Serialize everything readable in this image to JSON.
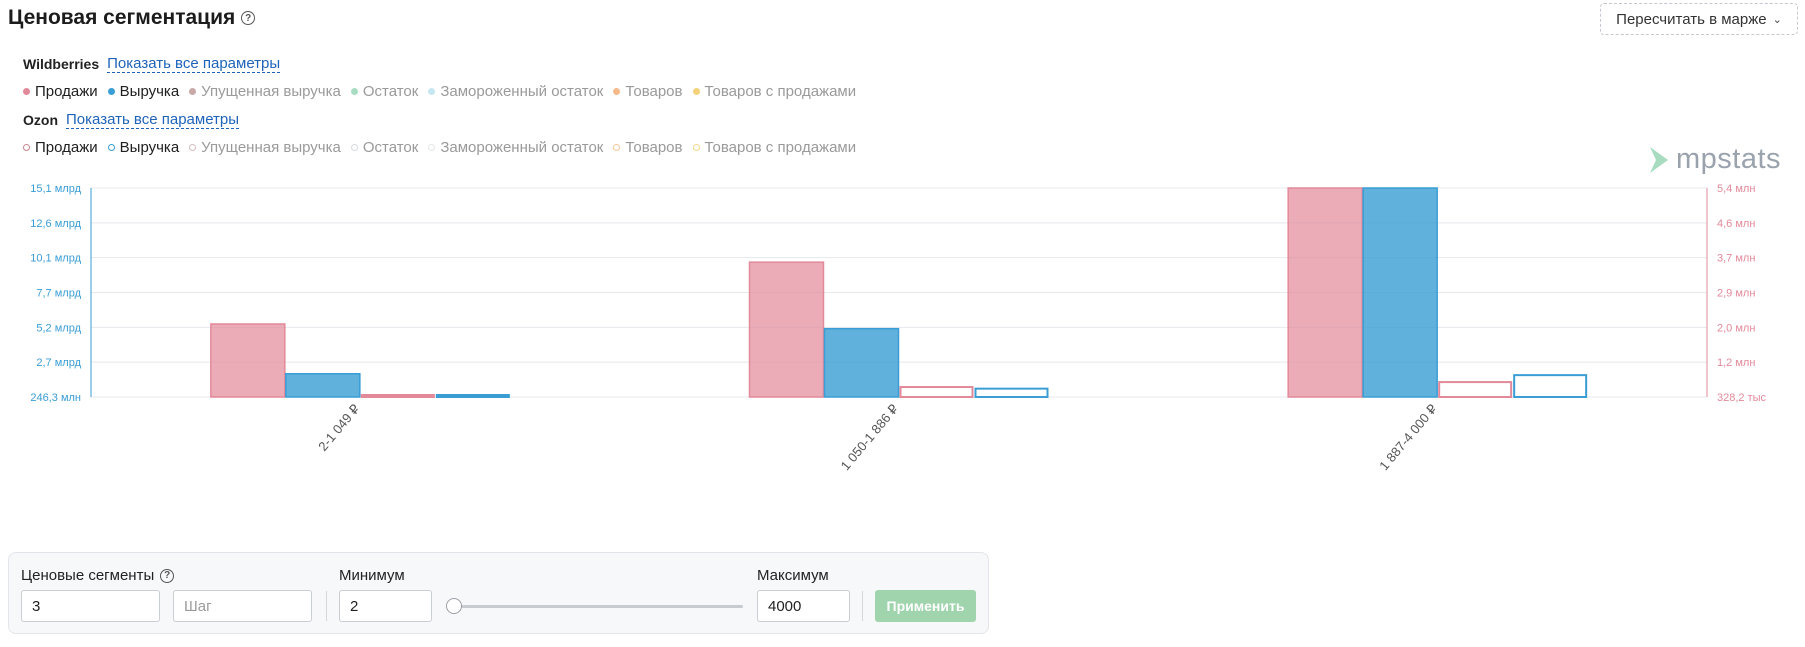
{
  "header": {
    "title": "Ценовая сегментация",
    "recalc_label": "Пересчитать в марже"
  },
  "sources": [
    {
      "name": "Wildberries",
      "link": "Показать все параметры",
      "legend": [
        {
          "label": "Продажи",
          "color": "#e2899a",
          "active": true
        },
        {
          "label": "Выручка",
          "color": "#3a9dd4",
          "active": true
        },
        {
          "label": "Упущенная выручка",
          "color": "#c9a8a8",
          "active": false
        },
        {
          "label": "Остаток",
          "color": "#a8dcc0",
          "active": false
        },
        {
          "label": "Замороженный остаток",
          "color": "#c6e6f0",
          "active": false
        },
        {
          "label": "Товаров",
          "color": "#f6b98a",
          "active": false
        },
        {
          "label": "Товаров с продажами",
          "color": "#f5d27a",
          "active": false
        }
      ]
    },
    {
      "name": "Ozon",
      "link": "Показать все параметры",
      "legend": [
        {
          "label": "Продажи",
          "color": "#c9868f",
          "active": true
        },
        {
          "label": "Выручка",
          "color": "#3a9dd4",
          "active": true
        },
        {
          "label": "Упущенная выручка",
          "color": "#d4bcbc",
          "active": false
        },
        {
          "label": "Остаток",
          "color": "#d8dcdf",
          "active": false
        },
        {
          "label": "Замороженный остаток",
          "color": "#e3e6e8",
          "active": false
        },
        {
          "label": "Товаров",
          "color": "#f6c69a",
          "active": false
        },
        {
          "label": "Товаров с продажами",
          "color": "#f5d88a",
          "active": false
        }
      ]
    }
  ],
  "logo": {
    "text": "mpstats"
  },
  "chart_data": {
    "type": "bar",
    "categories": [
      "2-1 049 ₽",
      "1 050-1 886 ₽",
      "1 887-4 000 ₽"
    ],
    "left_axis": {
      "ticks": [
        "15,1 млрд",
        "12,6 млрд",
        "10,1 млрд",
        "7,7 млрд",
        "5,2 млрд",
        "2,7 млрд",
        "246,3 млн"
      ],
      "range": [
        246300000,
        15100000000
      ],
      "color": "#3a9dd4"
    },
    "right_axis": {
      "ticks": [
        "5,4 млн",
        "4,6 млн",
        "3,7 млн",
        "2,9 млн",
        "2,0 млн",
        "1,2 млн",
        "328,2 тыс"
      ],
      "range": [
        328200,
        5400000
      ],
      "color": "#e2899a"
    },
    "series": [
      {
        "name": "Продажи",
        "source": "Wildberries",
        "axis": "right",
        "style": "filled",
        "color": "#e2899a",
        "values": [
          2100000,
          3600000,
          5400000
        ]
      },
      {
        "name": "Выручка",
        "source": "Wildberries",
        "axis": "left",
        "style": "filled",
        "color": "#3a9dd4",
        "values": [
          1900000000,
          5100000000,
          15100000000
        ]
      },
      {
        "name": "Продажи",
        "source": "Ozon",
        "axis": "right",
        "style": "outline",
        "color": "#e2899a",
        "values": [
          360000,
          570000,
          690000
        ]
      },
      {
        "name": "Выручка",
        "source": "Ozon",
        "axis": "left",
        "style": "outline",
        "color": "#3a9dd4",
        "values": [
          300000000,
          840000000,
          1800000000
        ]
      }
    ],
    "grid": true
  },
  "controls": {
    "segments_label": "Ценовые сегменты",
    "segments_value": "3",
    "step_placeholder": "Шаг",
    "min_label": "Минимум",
    "min_value": "2",
    "max_label": "Максимум",
    "max_value": "4000",
    "slider_value": 2,
    "apply_label": "Применить"
  }
}
